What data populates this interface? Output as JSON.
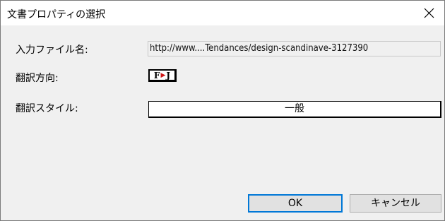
{
  "window": {
    "title": "文書プロパティの選択",
    "close_icon": "close-icon"
  },
  "form": {
    "input_file_label": "入力ファイル名:",
    "input_file_value": "http://www....Tendances/design-scandinave-3127390",
    "direction_label": "翻訳方向:",
    "direction_badge": {
      "from": "F",
      "arrow": "▶",
      "to": "J"
    },
    "style_label": "翻訳スタイル:",
    "style_value": "一般"
  },
  "buttons": {
    "ok": "OK",
    "cancel": "キャンセル"
  },
  "colors": {
    "accent": "#0078d7",
    "arrow": "#d01818"
  }
}
